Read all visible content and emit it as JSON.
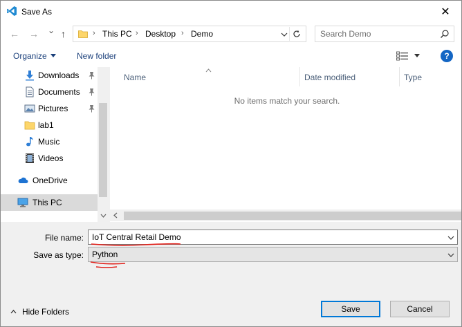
{
  "window": {
    "title": "Save As",
    "close_glyph": "✕"
  },
  "nav": {
    "back_glyph": "←",
    "forward_glyph": "→",
    "recent_glyph": "⌄",
    "up_glyph": "↑",
    "breadcrumbs": [
      "This PC",
      "Desktop",
      "Demo"
    ],
    "separator": "›",
    "search_placeholder": "Search Demo"
  },
  "toolbar": {
    "organize_label": "Organize",
    "new_folder_label": "New folder",
    "help_label": "?"
  },
  "sidebar": {
    "items": [
      {
        "label": "Downloads",
        "icon": "downloads-icon",
        "pinned": true
      },
      {
        "label": "Documents",
        "icon": "documents-icon",
        "pinned": true
      },
      {
        "label": "Pictures",
        "icon": "pictures-icon",
        "pinned": true
      },
      {
        "label": "lab1",
        "icon": "folder-icon",
        "pinned": false
      },
      {
        "label": "Music",
        "icon": "music-icon",
        "pinned": false
      },
      {
        "label": "Videos",
        "icon": "videos-icon",
        "pinned": false
      },
      {
        "label": "OneDrive",
        "icon": "onedrive-icon",
        "pinned": false
      },
      {
        "label": "This PC",
        "icon": "this-pc-icon",
        "pinned": false,
        "selected": true
      }
    ]
  },
  "file_list": {
    "columns": [
      "Name",
      "Date modified",
      "Type"
    ],
    "empty_message": "No items match your search."
  },
  "form": {
    "file_name_label": "File name:",
    "file_name_value": "IoT Central Retail Demo",
    "save_as_type_label": "Save as type:",
    "save_as_type_value": "Python"
  },
  "footer": {
    "hide_folders_label": "Hide Folders",
    "save_label": "Save",
    "cancel_label": "Cancel"
  },
  "colors": {
    "accent": "#0078d7",
    "link": "#1a3f7a",
    "annotation_red": "#e0201a"
  }
}
